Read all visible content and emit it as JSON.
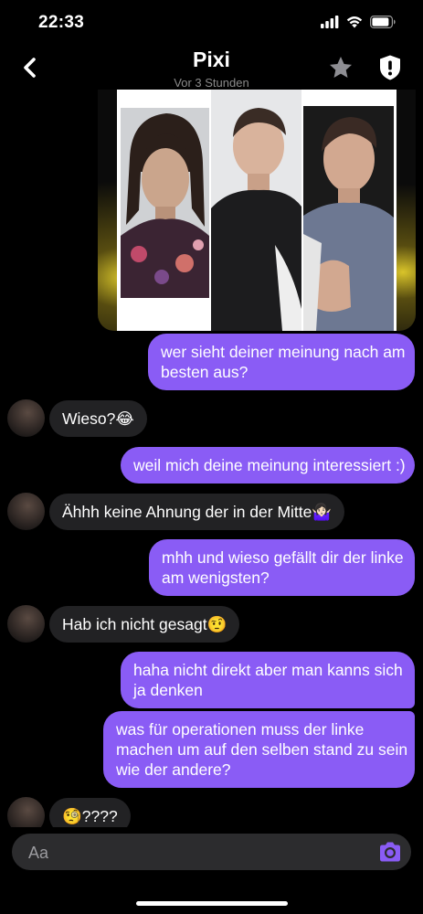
{
  "status_bar": {
    "time": "22:33"
  },
  "header": {
    "title": "Pixi",
    "subtitle": "Vor 3 Stunden"
  },
  "messages": [
    {
      "direction": "out",
      "text_lines": [
        "wer sieht deiner meinung nach am",
        "besten aus?"
      ]
    },
    {
      "direction": "in",
      "text": "Wieso?😂"
    },
    {
      "direction": "out",
      "text": "weil mich deine meinung interessiert :)"
    },
    {
      "direction": "in",
      "text": "Ähhh keine Ahnung der in der Mitte🤷🏻‍♀️"
    },
    {
      "direction": "out",
      "text_lines": [
        "mhh und wieso gefällt dir der linke",
        "am wenigsten?"
      ]
    },
    {
      "direction": "in",
      "text": "Hab ich nicht gesagt🤨"
    },
    {
      "direction": "out",
      "text_lines": [
        "haha nicht direkt aber man kanns sich",
        "ja denken"
      ]
    },
    {
      "direction": "out",
      "text_lines": [
        "was für operationen muss der linke",
        "machen um auf den selben stand zu sein",
        "wie der andere?"
      ]
    },
    {
      "direction": "in",
      "text": "🧐????"
    }
  ],
  "composer": {
    "placeholder": "Aa"
  },
  "colors": {
    "outgoing_bubble": "#8a5cf5",
    "incoming_bubble": "#222224",
    "background": "#000000",
    "accent": "#8a5cf5"
  },
  "icons": {
    "back": "chevron-left-icon",
    "favorite": "star-icon",
    "safety": "shield-icon",
    "camera": "camera-icon",
    "signal": "signal-icon",
    "wifi": "wifi-icon",
    "battery": "battery-icon"
  }
}
